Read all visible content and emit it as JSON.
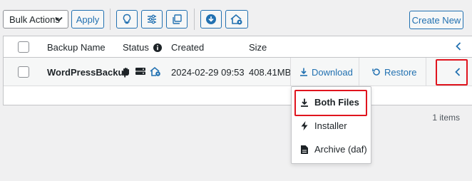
{
  "toolbar": {
    "bulk_actions_label": "Bulk Actions",
    "apply_label": "Apply",
    "create_new_label": "Create New",
    "icons": [
      "lightbulb-icon",
      "sliders-icon",
      "copy-icon",
      "download-circle-icon",
      "home-gear-icon"
    ]
  },
  "table": {
    "columns": {
      "name": "Backup Name",
      "status": "Status",
      "created": "Created",
      "size": "Size"
    },
    "rows": [
      {
        "name": "WordPressBackup",
        "status_icons": [
          "hand-icon",
          "storage-icon",
          "home-gear-icon"
        ],
        "created": "2024-02-29 09:53",
        "size": "408.41MB",
        "download_label": "Download",
        "restore_label": "Restore"
      }
    ]
  },
  "download_menu": {
    "items": [
      {
        "label": "Both Files",
        "icon": "download-icon"
      },
      {
        "label": "Installer",
        "icon": "bolt-icon"
      },
      {
        "label": "Archive (daf)",
        "icon": "file-icon"
      }
    ]
  },
  "items_count": "1 items",
  "colors": {
    "accent": "#2271b1",
    "highlight": "#e0141e",
    "background": "#f0f0f1"
  }
}
